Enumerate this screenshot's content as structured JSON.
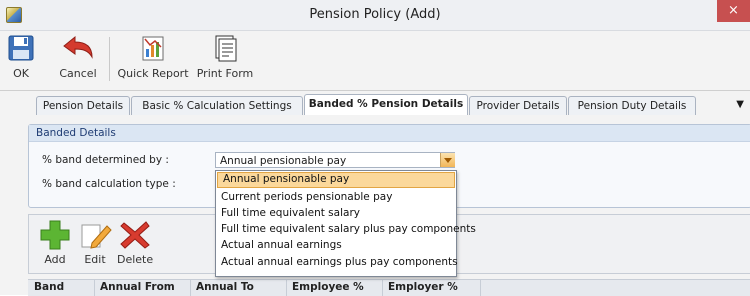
{
  "window": {
    "title": "Pension Policy (Add)",
    "close_glyph": "×"
  },
  "toolbar": {
    "ok": "OK",
    "cancel": "Cancel",
    "quick_report": "Quick Report",
    "print_form": "Print Form"
  },
  "tabs": [
    "Pension Details",
    "Basic % Calculation Settings",
    "Banded % Pension Details",
    "Provider Details",
    "Pension Duty Details"
  ],
  "active_tab": "Banded % Pension Details",
  "panel": {
    "header": "Banded Details",
    "band_determined_label": "% band determined by :",
    "band_determined_value": "Annual pensionable pay",
    "band_calc_label": "% band calculation type :"
  },
  "dropdown": {
    "options": [
      "Annual pensionable pay",
      "Current periods pensionable pay",
      "Full time equivalent salary",
      "Full time equivalent salary plus pay components",
      "Actual annual earnings",
      "Actual annual earnings plus pay components"
    ],
    "selected_index": 0
  },
  "band_toolbar": {
    "add": "Add",
    "edit": "Edit",
    "delete": "Delete"
  },
  "grid": {
    "columns": [
      "Band",
      "Annual From",
      "Annual To",
      "Employee %",
      "Employer %"
    ]
  },
  "colors": {
    "accent_orange": "#fbd89b",
    "close_red": "#c75050",
    "panel_header": "#dbe6f3"
  }
}
